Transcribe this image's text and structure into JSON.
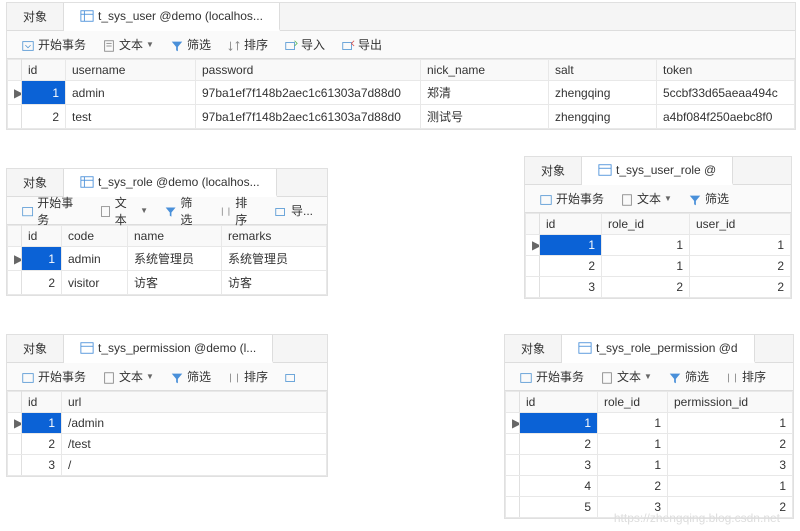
{
  "common": {
    "object_tab": "对象",
    "begin_tx": "开始事务",
    "text": "文本",
    "filter": "筛选",
    "sort": "排序",
    "import": "导入",
    "export": "导出"
  },
  "user": {
    "title": "t_sys_user @demo (localhos...",
    "cols": {
      "id": "id",
      "username": "username",
      "password": "password",
      "nick_name": "nick_name",
      "salt": "salt",
      "token": "token"
    },
    "rows": [
      {
        "id": "1",
        "username": "admin",
        "password": "97ba1ef7f148b2aec1c61303a7d88d0",
        "nick_name": "郑清",
        "salt": "zhengqing",
        "token": "5ccbf33d65aeaa494c"
      },
      {
        "id": "2",
        "username": "test",
        "password": "97ba1ef7f148b2aec1c61303a7d88d0",
        "nick_name": "测试号",
        "salt": "zhengqing",
        "token": "a4bf084f250aebc8f0"
      }
    ]
  },
  "role": {
    "title": "t_sys_role @demo (localhos...",
    "cols": {
      "id": "id",
      "code": "code",
      "name": "name",
      "remarks": "remarks"
    },
    "rows": [
      {
        "id": "1",
        "code": "admin",
        "name": "系统管理员",
        "remarks": "系统管理员"
      },
      {
        "id": "2",
        "code": "visitor",
        "name": "访客",
        "remarks": "访客"
      }
    ],
    "import_short": "导..."
  },
  "user_role": {
    "title": "t_sys_user_role @",
    "filter_short": "筛选",
    "cols": {
      "id": "id",
      "role_id": "role_id",
      "user_id": "user_id"
    },
    "rows": [
      {
        "id": "1",
        "role_id": "1",
        "user_id": "1"
      },
      {
        "id": "2",
        "role_id": "1",
        "user_id": "2"
      },
      {
        "id": "3",
        "role_id": "2",
        "user_id": "2"
      }
    ]
  },
  "permission": {
    "title": "t_sys_permission @demo (l...",
    "cols": {
      "id": "id",
      "url": "url"
    },
    "rows": [
      {
        "id": "1",
        "url": "/admin"
      },
      {
        "id": "2",
        "url": "/test"
      },
      {
        "id": "3",
        "url": "/"
      }
    ]
  },
  "role_permission": {
    "title": "t_sys_role_permission @d",
    "cols": {
      "id": "id",
      "role_id": "role_id",
      "permission_id": "permission_id"
    },
    "rows": [
      {
        "id": "1",
        "role_id": "1",
        "permission_id": "1"
      },
      {
        "id": "2",
        "role_id": "1",
        "permission_id": "2"
      },
      {
        "id": "3",
        "role_id": "1",
        "permission_id": "3"
      },
      {
        "id": "4",
        "role_id": "2",
        "permission_id": "1"
      },
      {
        "id": "5",
        "role_id": "3",
        "permission_id": "2"
      }
    ]
  },
  "watermark": "https://zhengqing.blog.csdn.net"
}
